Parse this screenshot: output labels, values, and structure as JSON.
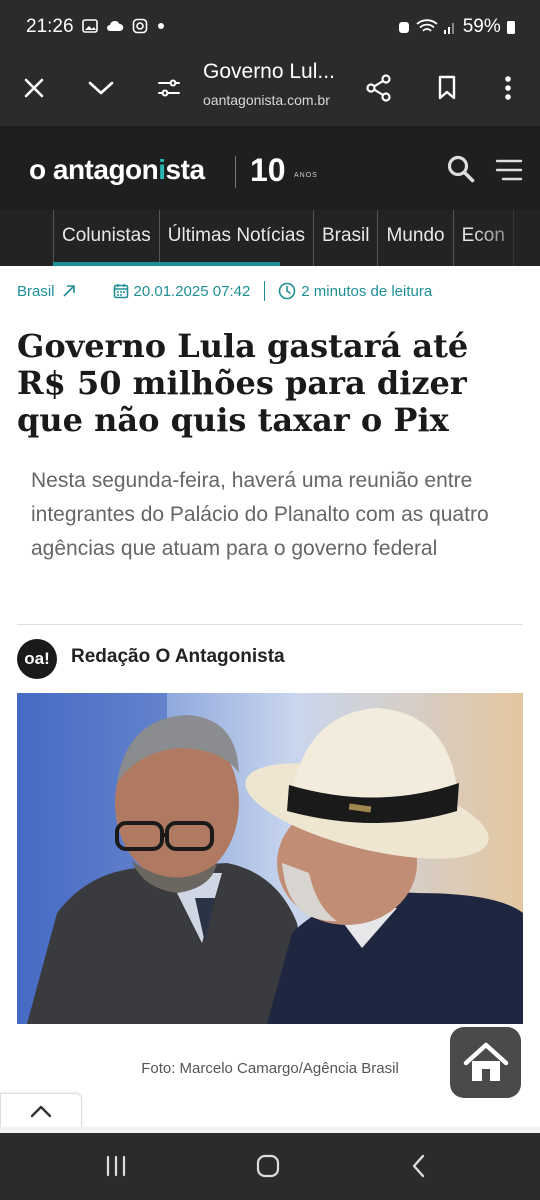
{
  "status_bar": {
    "time": "21:26",
    "battery": "59%",
    "status_icons": [
      "image-icon",
      "cloud-icon",
      "instagram-icon",
      "dot-icon"
    ]
  },
  "browser": {
    "page_title": "Governo Lul...",
    "host": "oantagonista.com.br"
  },
  "site": {
    "logo_prefix": "o antagon",
    "logo_i": "i",
    "logo_suffix": "sta",
    "anniversary_number": "10",
    "anniversary_label": "ANOS",
    "nav_items": [
      "Colunistas",
      "Últimas Notícias",
      "Brasil",
      "Mundo",
      "Econ"
    ]
  },
  "article": {
    "category": "Brasil",
    "date": "20.01.2025 07:42",
    "reading_time": "2 minutos de leitura",
    "headline": "Governo Lula gastará até R$ 50 milhões para dizer que não quis taxar o Pix",
    "lead": "Nesta segunda-feira, haverá uma reunião entre integrantes do Palácio do Planalto com as quatro agências que atuam para o governo federal",
    "author": {
      "avatar_text": "oa!",
      "name": "Redação O Antagonista"
    },
    "photo_caption": "Foto: Marcelo Camargo/Agência Brasil"
  },
  "colors": {
    "accent": "#1f8f96",
    "header_bg": "#1f1f1f",
    "nav_bg": "#232323",
    "system_bar": "#2b2b2b"
  }
}
